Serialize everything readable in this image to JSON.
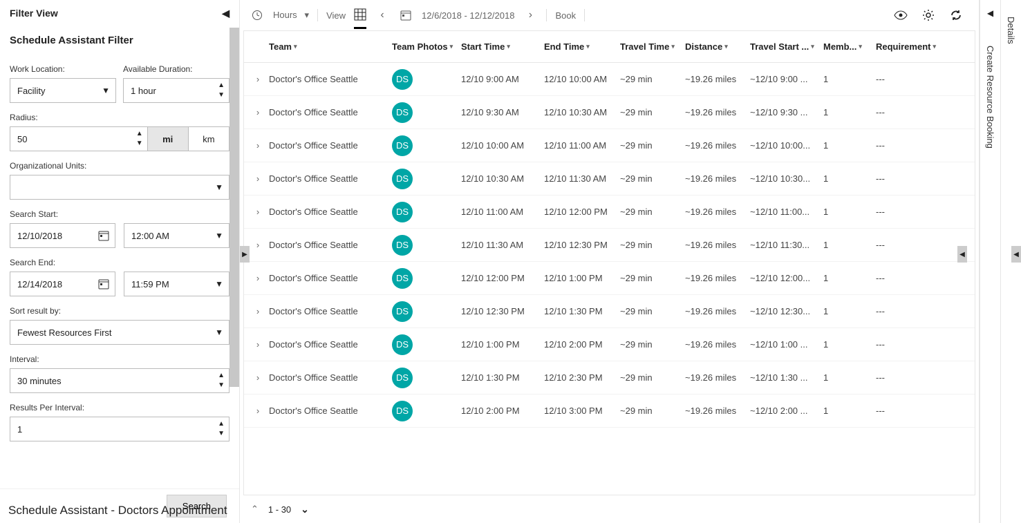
{
  "filterPanel": {
    "header": "Filter View",
    "subheader": "Schedule Assistant Filter",
    "workLocation": {
      "label": "Work Location:",
      "value": "Facility"
    },
    "availableDuration": {
      "label": "Available Duration:",
      "value": "1 hour"
    },
    "radius": {
      "label": "Radius:",
      "value": "50",
      "unit_mi": "mi",
      "unit_km": "km"
    },
    "orgUnits": {
      "label": "Organizational Units:",
      "value": ""
    },
    "searchStart": {
      "label": "Search Start:",
      "date": "12/10/2018",
      "time": "12:00 AM"
    },
    "searchEnd": {
      "label": "Search End:",
      "date": "12/14/2018",
      "time": "11:59 PM"
    },
    "sortBy": {
      "label": "Sort result by:",
      "value": "Fewest Resources First"
    },
    "interval": {
      "label": "Interval:",
      "value": "30 minutes"
    },
    "resultsPerInterval": {
      "label": "Results Per Interval:",
      "value": "1"
    },
    "searchButton": "Search"
  },
  "toolbar": {
    "hours": "Hours",
    "view": "View",
    "dateRange": "12/6/2018 - 12/12/2018",
    "book": "Book"
  },
  "table": {
    "headers": {
      "team": "Team",
      "photos": "Team Photos",
      "start": "Start Time",
      "end": "End Time",
      "travel": "Travel Time",
      "distance": "Distance",
      "travelStart": "Travel Start ...",
      "members": "Memb...",
      "requirement": "Requirement"
    },
    "badge": "DS",
    "rows": [
      {
        "team": "Doctor's Office Seattle",
        "start": "12/10 9:00 AM",
        "end": "12/10 10:00 AM",
        "travel": "~29 min",
        "dist": "~19.26 miles",
        "tstart": "~12/10 9:00 ...",
        "mem": "1",
        "req": "---"
      },
      {
        "team": "Doctor's Office Seattle",
        "start": "12/10 9:30 AM",
        "end": "12/10 10:30 AM",
        "travel": "~29 min",
        "dist": "~19.26 miles",
        "tstart": "~12/10 9:30 ...",
        "mem": "1",
        "req": "---"
      },
      {
        "team": "Doctor's Office Seattle",
        "start": "12/10 10:00 AM",
        "end": "12/10 11:00 AM",
        "travel": "~29 min",
        "dist": "~19.26 miles",
        "tstart": "~12/10 10:00...",
        "mem": "1",
        "req": "---"
      },
      {
        "team": "Doctor's Office Seattle",
        "start": "12/10 10:30 AM",
        "end": "12/10 11:30 AM",
        "travel": "~29 min",
        "dist": "~19.26 miles",
        "tstart": "~12/10 10:30...",
        "mem": "1",
        "req": "---"
      },
      {
        "team": "Doctor's Office Seattle",
        "start": "12/10 11:00 AM",
        "end": "12/10 12:00 PM",
        "travel": "~29 min",
        "dist": "~19.26 miles",
        "tstart": "~12/10 11:00...",
        "mem": "1",
        "req": "---"
      },
      {
        "team": "Doctor's Office Seattle",
        "start": "12/10 11:30 AM",
        "end": "12/10 12:30 PM",
        "travel": "~29 min",
        "dist": "~19.26 miles",
        "tstart": "~12/10 11:30...",
        "mem": "1",
        "req": "---"
      },
      {
        "team": "Doctor's Office Seattle",
        "start": "12/10 12:00 PM",
        "end": "12/10 1:00 PM",
        "travel": "~29 min",
        "dist": "~19.26 miles",
        "tstart": "~12/10 12:00...",
        "mem": "1",
        "req": "---"
      },
      {
        "team": "Doctor's Office Seattle",
        "start": "12/10 12:30 PM",
        "end": "12/10 1:30 PM",
        "travel": "~29 min",
        "dist": "~19.26 miles",
        "tstart": "~12/10 12:30...",
        "mem": "1",
        "req": "---"
      },
      {
        "team": "Doctor's Office Seattle",
        "start": "12/10 1:00 PM",
        "end": "12/10 2:00 PM",
        "travel": "~29 min",
        "dist": "~19.26 miles",
        "tstart": "~12/10 1:00 ...",
        "mem": "1",
        "req": "---"
      },
      {
        "team": "Doctor's Office Seattle",
        "start": "12/10 1:30 PM",
        "end": "12/10 2:30 PM",
        "travel": "~29 min",
        "dist": "~19.26 miles",
        "tstart": "~12/10 1:30 ...",
        "mem": "1",
        "req": "---"
      },
      {
        "team": "Doctor's Office Seattle",
        "start": "12/10 2:00 PM",
        "end": "12/10 3:00 PM",
        "travel": "~29 min",
        "dist": "~19.26 miles",
        "tstart": "~12/10 2:00 ...",
        "mem": "1",
        "req": "---"
      }
    ],
    "pager": "1 - 30"
  },
  "rails": {
    "create": "Create Resource Booking",
    "details": "Details"
  },
  "footer": {
    "title": "Schedule Assistant - Doctors Appointment"
  }
}
